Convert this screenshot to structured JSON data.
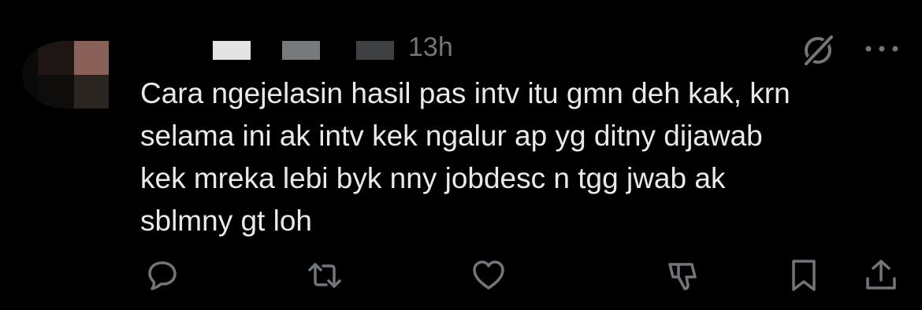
{
  "post": {
    "timestamp": "13h",
    "text": "Cara ngejelasin hasil pas intv itu gmn deh kak, krn\nselama ini ak intv kek ngalur ap yg ditny dijawab\nkek mreka lebi byk nny jobdesc n tgg jwab ak\nsblmny gt loh"
  },
  "icons": {
    "grok": "grok-icon",
    "more": "more-icon",
    "reply": "reply-icon",
    "repost": "repost-icon",
    "like": "heart-icon",
    "dislike": "downvote-icon",
    "bookmark": "bookmark-icon",
    "share": "share-icon"
  },
  "colors": {
    "background": "#000000",
    "text": "#e7e9ea",
    "secondary": "#71767b"
  }
}
